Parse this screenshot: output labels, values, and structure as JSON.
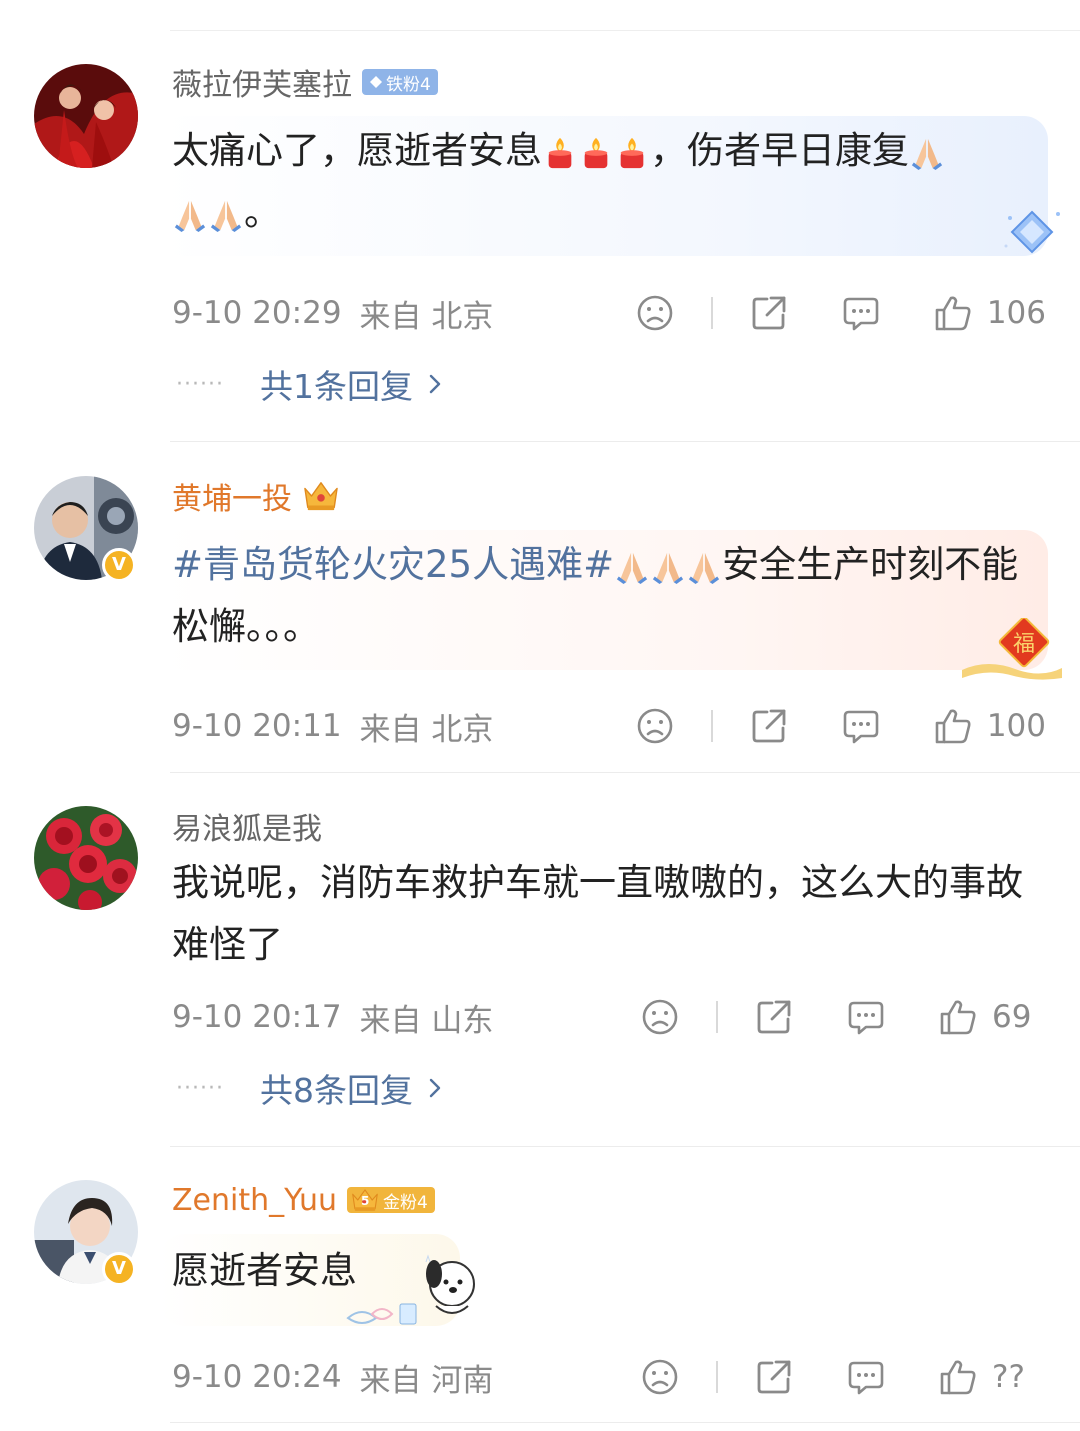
{
  "comments": [
    {
      "username": "薇拉伊芙塞拉",
      "fan_badge": "铁粉4",
      "text_before": "太痛心了，愿逝者安息",
      "text_middle": "，伤者早日康复",
      "text_end": "。",
      "time": "9-10 20:29",
      "location": "来自 北京",
      "likes": "106",
      "replies": "共1条回复"
    },
    {
      "username": "黄埔一投",
      "verified": "V",
      "hashtag": "#青岛货轮火灾25人遇难#",
      "text_after": "安全生产时刻不能松懈。。。",
      "sticker_char": "福",
      "time": "9-10 20:11",
      "location": "来自 北京",
      "likes": "100"
    },
    {
      "username": "易浪狐是我",
      "text": "我说呢，消防车救护车就一直嗷嗷的，这么大的事故难怪了",
      "time": "9-10 20:17",
      "location": "来自 山东",
      "likes": "69",
      "replies": "共8条回复"
    },
    {
      "username": "Zenith_Yuu",
      "verified": "V",
      "fan_badge": "金粉4",
      "crown_level": "5",
      "text": "愿逝者安息",
      "time": "9-10 20:24",
      "location": "来自 河南",
      "likes": "??"
    }
  ],
  "reply_dots": "······",
  "icons": {
    "dislike": "frown-icon",
    "share": "share-icon",
    "comment": "comment-icon",
    "like": "thumbs-up-icon",
    "chevron": "chevron-right-icon"
  },
  "colors": {
    "link_blue": "#52729e",
    "meta_gray": "#8a8a8a",
    "gold_name": "#e0782b"
  }
}
